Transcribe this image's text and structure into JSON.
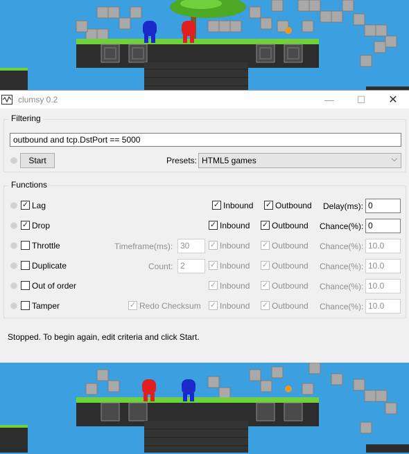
{
  "window": {
    "title": "clumsy 0.2",
    "minimize_glyph": "—",
    "maximize_glyph": "☐",
    "close_glyph": "✕"
  },
  "filtering": {
    "legend": "Filtering",
    "filter_value": "outbound and tcp.DstPort == 5000",
    "start_label": "Start",
    "presets_label": "Presets:",
    "presets_value": "HTML5 games"
  },
  "functions": {
    "legend": "Functions",
    "rows": [
      {
        "label": "Lag",
        "checked": true,
        "param_label": "",
        "param_value": "",
        "inbound_label": "Inbound",
        "outbound_label": "Outbound",
        "right_label": "Delay(ms):",
        "right_value": "0"
      },
      {
        "label": "Drop",
        "checked": true,
        "param_label": "",
        "param_value": "",
        "inbound_label": "Inbound",
        "outbound_label": "Outbound",
        "right_label": "Chance(%):",
        "right_value": "0"
      },
      {
        "label": "Throttle",
        "checked": false,
        "param_label": "Timeframe(ms):",
        "param_value": "30",
        "inbound_label": "Inbound",
        "outbound_label": "Outbound",
        "right_label": "Chance(%):",
        "right_value": "10.0"
      },
      {
        "label": "Duplicate",
        "checked": false,
        "param_label": "Count:",
        "param_value": "2",
        "inbound_label": "Inbound",
        "outbound_label": "Outbound",
        "right_label": "Chance(%):",
        "right_value": "10.0"
      },
      {
        "label": "Out of order",
        "checked": false,
        "param_label": "",
        "param_value": "",
        "inbound_label": "Inbound",
        "outbound_label": "Outbound",
        "right_label": "Chance(%):",
        "right_value": "10.0"
      },
      {
        "label": "Tamper",
        "checked": false,
        "param_label": "Redo Checksum",
        "param_value": "",
        "inbound_label": "Inbound",
        "outbound_label": "Outbound",
        "right_label": "Chance(%):",
        "right_value": "10.0"
      }
    ]
  },
  "status_text": "Stopped. To begin again, edit criteria and click Start.",
  "colors": {
    "sky": "#3c9fe0",
    "grass": "#6fd23c",
    "stone": "#9e9e9e",
    "player_blue": "#1a2ac8",
    "player_red": "#e02020"
  }
}
